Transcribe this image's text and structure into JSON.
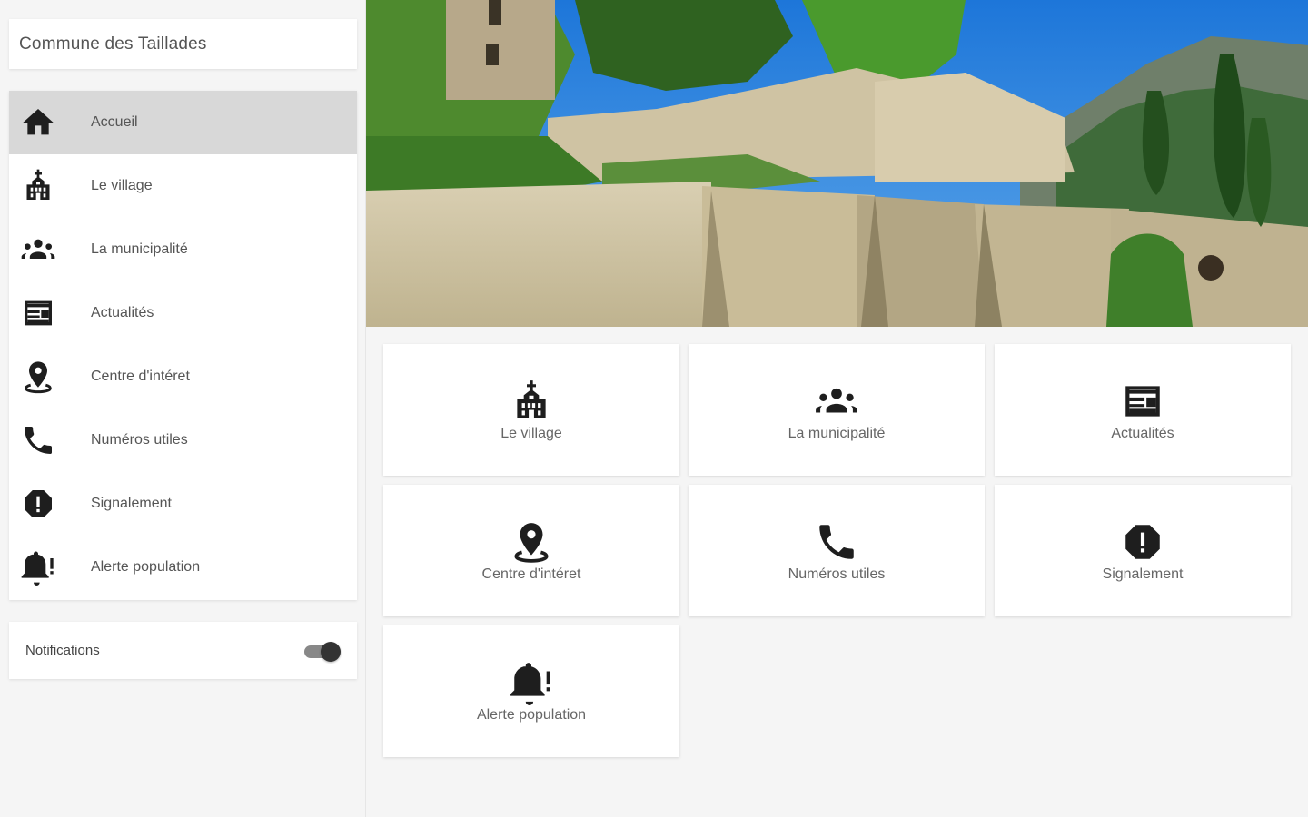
{
  "app": {
    "title": "Commune des Taillades"
  },
  "sidebar": {
    "items": [
      {
        "label": "Accueil",
        "icon": "home-icon",
        "active": true
      },
      {
        "label": "Le village",
        "icon": "church-icon"
      },
      {
        "label": "La municipalité",
        "icon": "groups-icon"
      },
      {
        "label": "Actualités",
        "icon": "newspaper-icon"
      },
      {
        "label": "Centre d'intéret",
        "icon": "location-pin-icon"
      },
      {
        "label": "Numéros utiles",
        "icon": "phone-icon"
      },
      {
        "label": "Signalement",
        "icon": "report-icon"
      },
      {
        "label": "Alerte population",
        "icon": "alert-bell-icon"
      }
    ],
    "notifications": {
      "label": "Notifications",
      "enabled": true
    }
  },
  "tiles": [
    {
      "label": "Le village",
      "icon": "church-icon"
    },
    {
      "label": "La municipalité",
      "icon": "groups-icon"
    },
    {
      "label": "Actualités",
      "icon": "newspaper-icon"
    },
    {
      "label": "Centre d'intéret",
      "icon": "location-pin-icon"
    },
    {
      "label": "Numéros utiles",
      "icon": "phone-icon"
    },
    {
      "label": "Signalement",
      "icon": "report-icon"
    },
    {
      "label": "Alerte population",
      "icon": "alert-bell-icon"
    }
  ],
  "colors": {
    "icon": "#1e1e1e",
    "active_item": "#d8d8d8",
    "background": "#f5f5f5"
  }
}
